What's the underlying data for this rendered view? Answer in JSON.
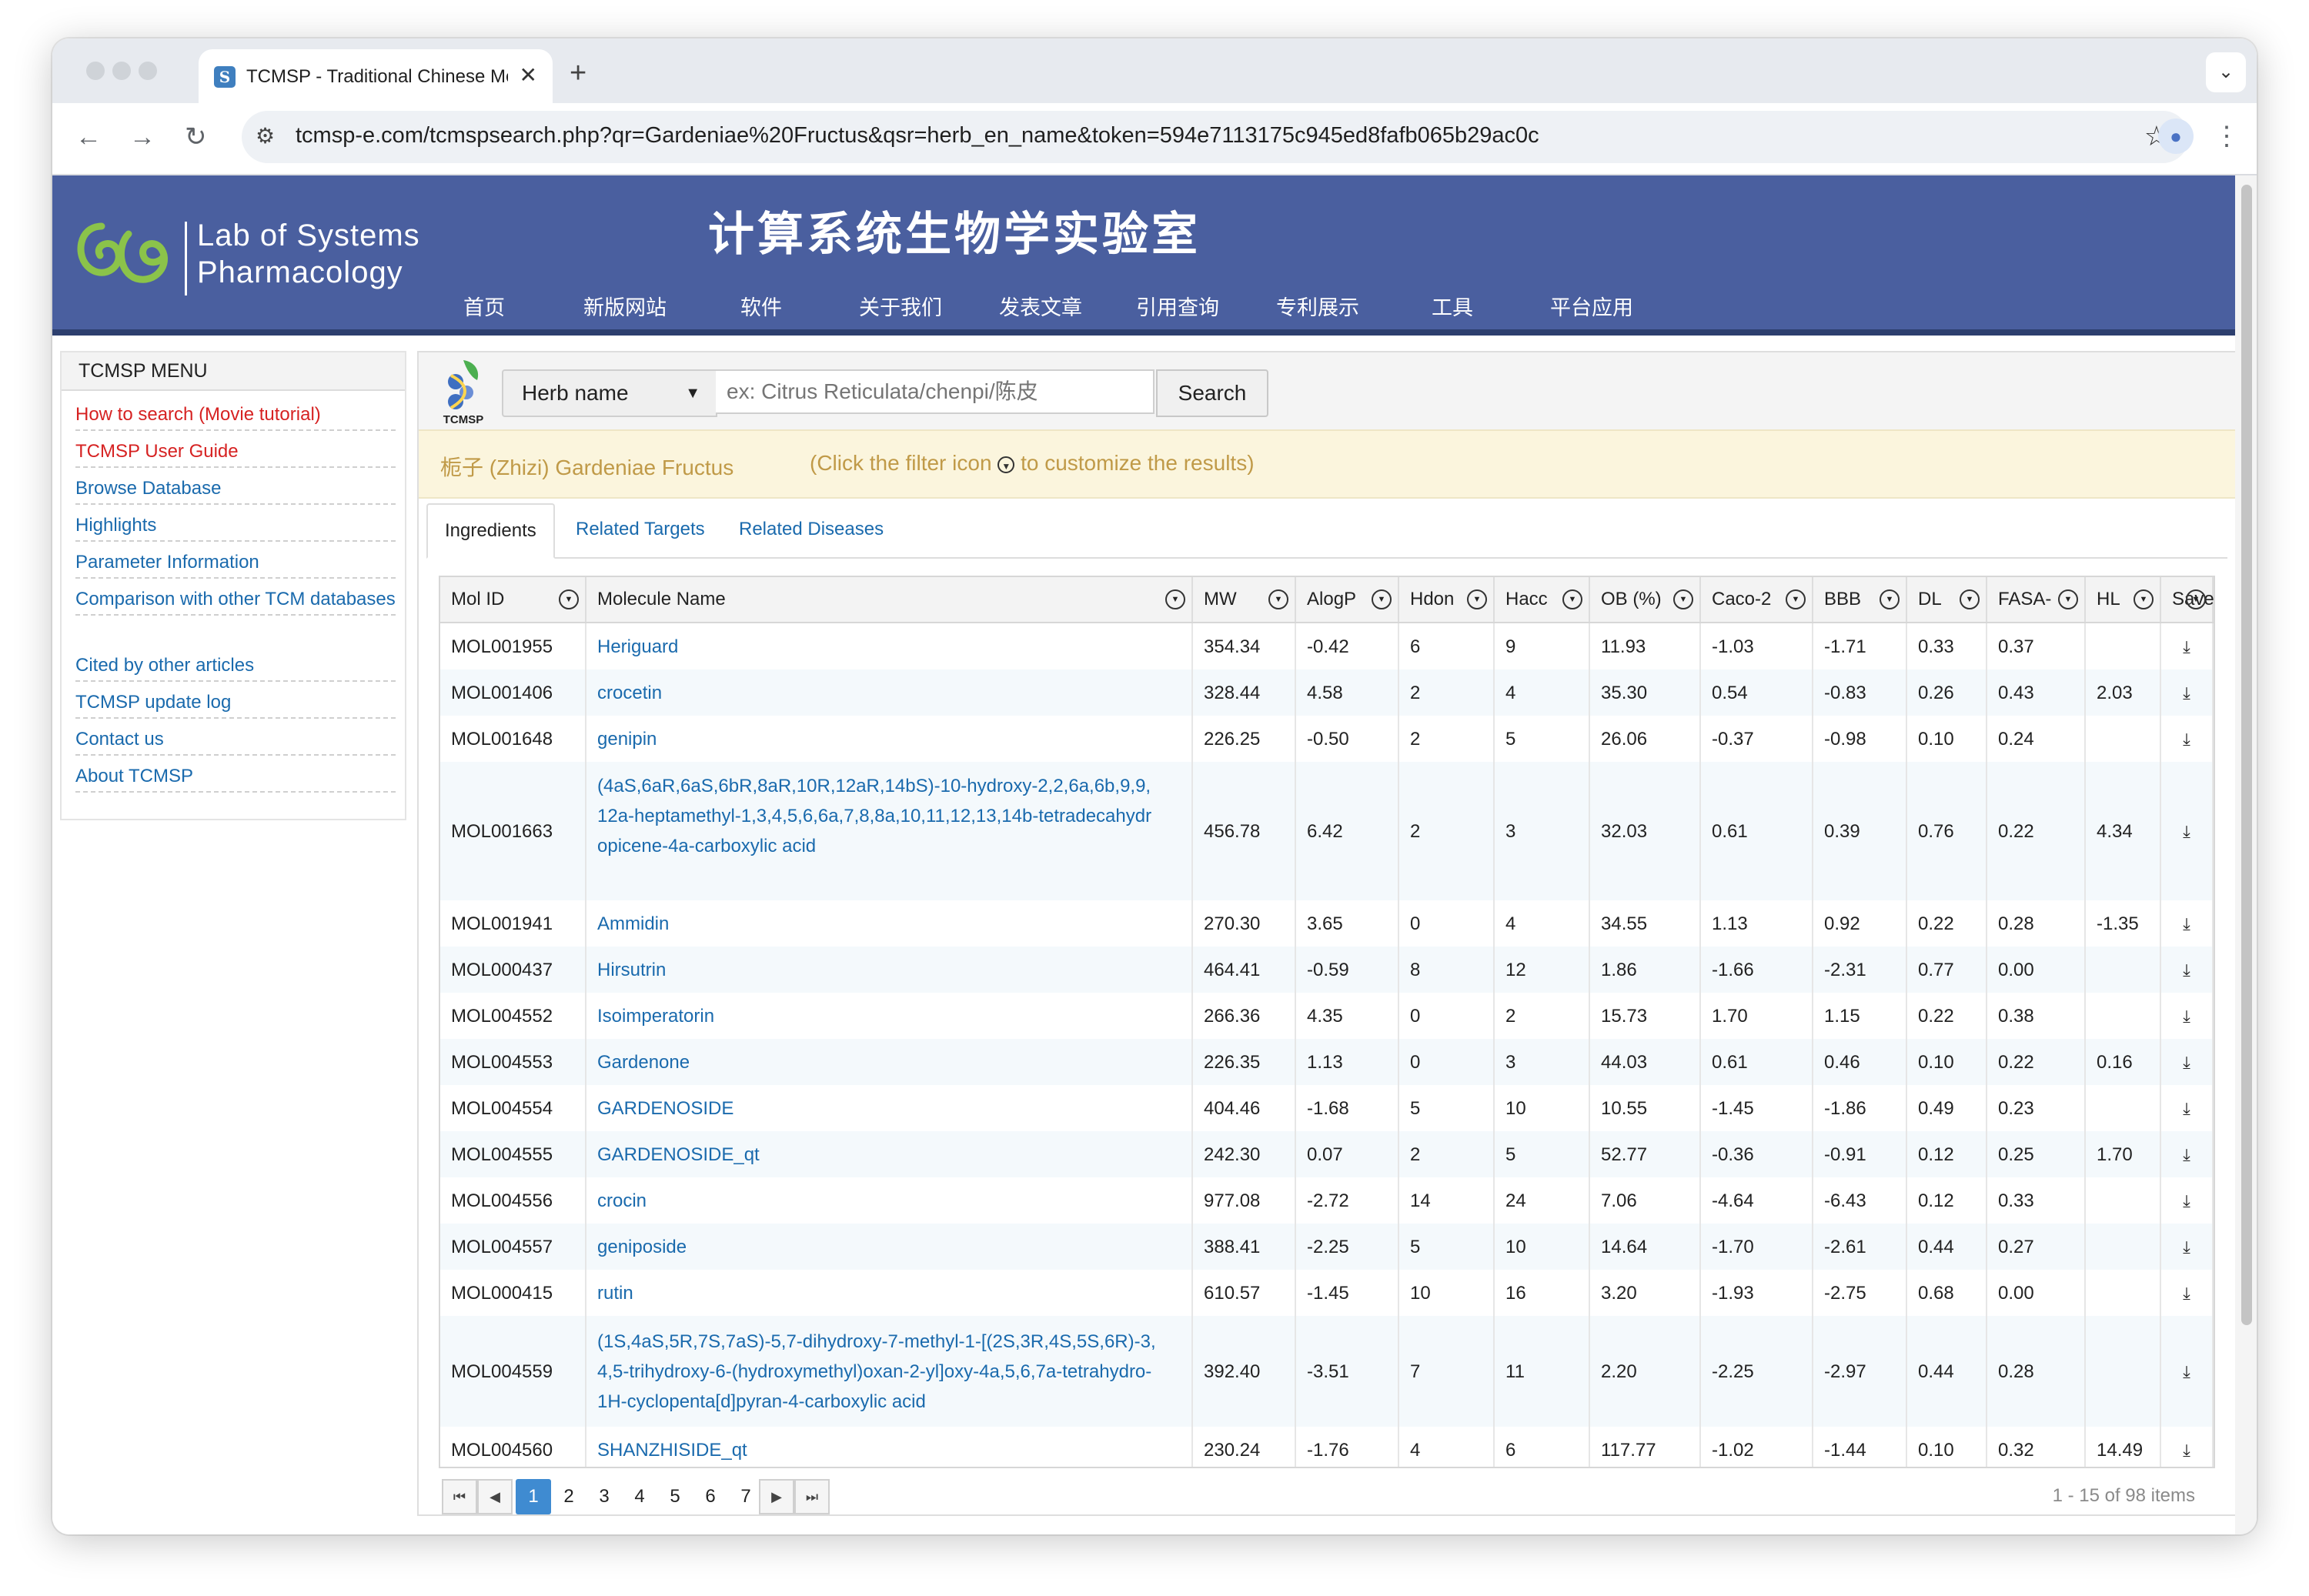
{
  "browser": {
    "tab_title": "TCMSP - Traditional Chinese Medicine",
    "tab_favicon": "S",
    "close_glyph": "✕",
    "new_tab_glyph": "+",
    "url": "tcmsp-e.com/tcmspsearch.php?qr=Gardeniae%20Fructus&qsr=herb_en_name&token=594e7113175c945ed8fafb065b29ac0c"
  },
  "header": {
    "logo_line1": "Lab of Systems",
    "logo_line2": "Pharmacology",
    "title_cn": "计算系统生物学实验室",
    "nav": [
      "首页",
      "新版网站",
      "软件",
      "关于我们",
      "发表文章",
      "引用查询",
      "专利展示",
      "工具",
      "平台应用"
    ]
  },
  "sidebar": {
    "title": "TCMSP MENU",
    "items": [
      {
        "label": "How to search (Movie tutorial)",
        "style": "red"
      },
      {
        "label": "TCMSP User Guide",
        "style": "red"
      },
      {
        "label": "Browse Database",
        "style": "link"
      },
      {
        "label": "Highlights",
        "style": "link"
      },
      {
        "label": "Parameter Information",
        "style": "link"
      },
      {
        "label": "Comparison with other TCM databases",
        "style": "link"
      },
      {
        "label": "Cited by other articles",
        "style": "link"
      },
      {
        "label": "TCMSP update log",
        "style": "link"
      },
      {
        "label": "Contact us",
        "style": "link"
      },
      {
        "label": "About TCMSP",
        "style": "link"
      }
    ]
  },
  "search": {
    "logo_text": "TCMSP",
    "type_selected": "Herb name",
    "placeholder": "ex: Citrus Reticulata/chenpi/陈皮",
    "button_label": "Search"
  },
  "info": {
    "herb_label": "栀子 (Zhizi) Gardeniae Fructus",
    "hint_before": "(Click the filter icon",
    "hint_after": "to customize the results)"
  },
  "tabs": [
    "Ingredients",
    "Related Targets",
    "Related Diseases"
  ],
  "table": {
    "columns": [
      "Mol ID",
      "Molecule Name",
      "MW",
      "AlogP",
      "Hdon",
      "Hacc",
      "OB (%)",
      "Caco-2",
      "BBB",
      "DL",
      "FASA-",
      "HL",
      "Save"
    ],
    "rows": [
      {
        "id": "MOL001955",
        "name": "Heriguard",
        "mw": "354.34",
        "alogp": "-0.42",
        "hdon": "6",
        "hacc": "9",
        "ob": "11.93",
        "caco2": "-1.03",
        "bbb": "-1.71",
        "dl": "0.33",
        "fasa": "0.37",
        "hl": ""
      },
      {
        "id": "MOL001406",
        "name": "crocetin",
        "mw": "328.44",
        "alogp": "4.58",
        "hdon": "2",
        "hacc": "4",
        "ob": "35.30",
        "caco2": "0.54",
        "bbb": "-0.83",
        "dl": "0.26",
        "fasa": "0.43",
        "hl": "2.03"
      },
      {
        "id": "MOL001648",
        "name": "genipin",
        "mw": "226.25",
        "alogp": "-0.50",
        "hdon": "2",
        "hacc": "5",
        "ob": "26.06",
        "caco2": "-0.37",
        "bbb": "-0.98",
        "dl": "0.10",
        "fasa": "0.24",
        "hl": ""
      },
      {
        "id": "MOL001663",
        "name": "(4aS,6aR,6aS,6bR,8aR,10R,12aR,14bS)-10-hydroxy-2,2,6a,6b,9,9,12a-heptamethyl-1,3,4,5,6,6a,7,8,8a,10,11,12,13,14b-tetradecahydropicene-4a-carboxylic acid",
        "mw": "456.78",
        "alogp": "6.42",
        "hdon": "2",
        "hacc": "3",
        "ob": "32.03",
        "caco2": "0.61",
        "bbb": "0.39",
        "dl": "0.76",
        "fasa": "0.22",
        "hl": "4.34"
      },
      {
        "id": "MOL001941",
        "name": "Ammidin",
        "mw": "270.30",
        "alogp": "3.65",
        "hdon": "0",
        "hacc": "4",
        "ob": "34.55",
        "caco2": "1.13",
        "bbb": "0.92",
        "dl": "0.22",
        "fasa": "0.28",
        "hl": "-1.35"
      },
      {
        "id": "MOL000437",
        "name": "Hirsutrin",
        "mw": "464.41",
        "alogp": "-0.59",
        "hdon": "8",
        "hacc": "12",
        "ob": "1.86",
        "caco2": "-1.66",
        "bbb": "-2.31",
        "dl": "0.77",
        "fasa": "0.00",
        "hl": ""
      },
      {
        "id": "MOL004552",
        "name": "Isoimperatorin",
        "mw": "266.36",
        "alogp": "4.35",
        "hdon": "0",
        "hacc": "2",
        "ob": "15.73",
        "caco2": "1.70",
        "bbb": "1.15",
        "dl": "0.22",
        "fasa": "0.38",
        "hl": ""
      },
      {
        "id": "MOL004553",
        "name": "Gardenone",
        "mw": "226.35",
        "alogp": "1.13",
        "hdon": "0",
        "hacc": "3",
        "ob": "44.03",
        "caco2": "0.61",
        "bbb": "0.46",
        "dl": "0.10",
        "fasa": "0.22",
        "hl": "0.16"
      },
      {
        "id": "MOL004554",
        "name": "GARDENOSIDE",
        "mw": "404.46",
        "alogp": "-1.68",
        "hdon": "5",
        "hacc": "10",
        "ob": "10.55",
        "caco2": "-1.45",
        "bbb": "-1.86",
        "dl": "0.49",
        "fasa": "0.23",
        "hl": ""
      },
      {
        "id": "MOL004555",
        "name": "GARDENOSIDE_qt",
        "mw": "242.30",
        "alogp": "0.07",
        "hdon": "2",
        "hacc": "5",
        "ob": "52.77",
        "caco2": "-0.36",
        "bbb": "-0.91",
        "dl": "0.12",
        "fasa": "0.25",
        "hl": "1.70"
      },
      {
        "id": "MOL004556",
        "name": "crocin",
        "mw": "977.08",
        "alogp": "-2.72",
        "hdon": "14",
        "hacc": "24",
        "ob": "7.06",
        "caco2": "-4.64",
        "bbb": "-6.43",
        "dl": "0.12",
        "fasa": "0.33",
        "hl": ""
      },
      {
        "id": "MOL004557",
        "name": "geniposide",
        "mw": "388.41",
        "alogp": "-2.25",
        "hdon": "5",
        "hacc": "10",
        "ob": "14.64",
        "caco2": "-1.70",
        "bbb": "-2.61",
        "dl": "0.44",
        "fasa": "0.27",
        "hl": ""
      },
      {
        "id": "MOL000415",
        "name": "rutin",
        "mw": "610.57",
        "alogp": "-1.45",
        "hdon": "10",
        "hacc": "16",
        "ob": "3.20",
        "caco2": "-1.93",
        "bbb": "-2.75",
        "dl": "0.68",
        "fasa": "0.00",
        "hl": ""
      },
      {
        "id": "MOL004559",
        "name": "(1S,4aS,5R,7S,7aS)-5,7-dihydroxy-7-methyl-1-[(2S,3R,4S,5S,6R)-3,4,5-trihydroxy-6-(hydroxymethyl)oxan-2-yl]oxy-4a,5,6,7a-tetrahydro-1H-cyclopenta[d]pyran-4-carboxylic acid",
        "mw": "392.40",
        "alogp": "-3.51",
        "hdon": "7",
        "hacc": "11",
        "ob": "2.20",
        "caco2": "-2.25",
        "bbb": "-2.97",
        "dl": "0.44",
        "fasa": "0.28",
        "hl": ""
      },
      {
        "id": "MOL004560",
        "name": "SHANZHISIDE_qt",
        "mw": "230.24",
        "alogp": "-1.76",
        "hdon": "4",
        "hacc": "6",
        "ob": "117.77",
        "caco2": "-1.02",
        "bbb": "-1.44",
        "dl": "0.10",
        "fasa": "0.32",
        "hl": "14.49"
      }
    ]
  },
  "pager": {
    "pages": [
      "1",
      "2",
      "3",
      "4",
      "5",
      "6",
      "7"
    ],
    "current_page": "1",
    "info": "1 - 15 of 98 items"
  },
  "icons": {
    "save": "save-download-icon",
    "filter": "filter-icon"
  },
  "colors": {
    "banner": "#4a5f9f",
    "link": "#1a6aad",
    "sidebar_red": "#d62222",
    "info_text": "#c09a48",
    "pager_active": "#3f8bd1"
  }
}
